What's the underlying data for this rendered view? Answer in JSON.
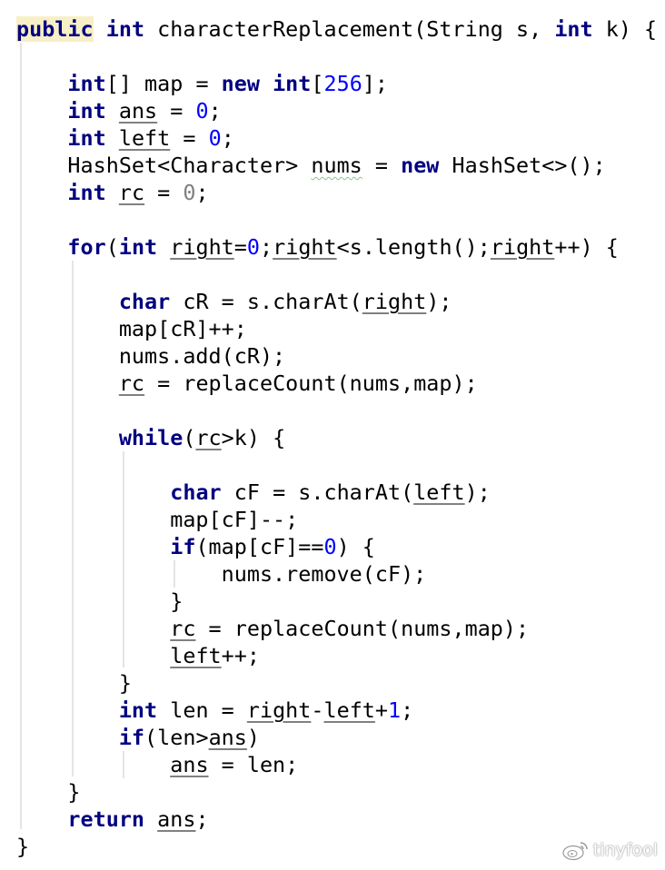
{
  "editor": {
    "lines": [
      [
        {
          "t": "public",
          "c": "kw hl"
        },
        {
          "t": " "
        },
        {
          "t": "int",
          "c": "kw"
        },
        {
          "t": " characterReplacement(String s, "
        },
        {
          "t": "int",
          "c": "kw"
        },
        {
          "t": " k) {"
        }
      ],
      [],
      [
        {
          "t": "    "
        },
        {
          "t": "int",
          "c": "kw"
        },
        {
          "t": "[] map = "
        },
        {
          "t": "new",
          "c": "kw"
        },
        {
          "t": " "
        },
        {
          "t": "int",
          "c": "kw"
        },
        {
          "t": "["
        },
        {
          "t": "256",
          "c": "num"
        },
        {
          "t": "];"
        }
      ],
      [
        {
          "t": "    "
        },
        {
          "t": "int",
          "c": "kw"
        },
        {
          "t": " "
        },
        {
          "t": "ans",
          "c": "field"
        },
        {
          "t": " = "
        },
        {
          "t": "0",
          "c": "num"
        },
        {
          "t": ";"
        }
      ],
      [
        {
          "t": "    "
        },
        {
          "t": "int",
          "c": "kw"
        },
        {
          "t": " "
        },
        {
          "t": "left",
          "c": "field"
        },
        {
          "t": " = "
        },
        {
          "t": "0",
          "c": "num"
        },
        {
          "t": ";"
        }
      ],
      [
        {
          "t": "    HashSet<Character> "
        },
        {
          "t": "nums",
          "c": "warn"
        },
        {
          "t": " = "
        },
        {
          "t": "new",
          "c": "kw"
        },
        {
          "t": " HashSet<>();"
        }
      ],
      [
        {
          "t": "    "
        },
        {
          "t": "int",
          "c": "kw"
        },
        {
          "t": " "
        },
        {
          "t": "rc",
          "c": "field"
        },
        {
          "t": " = "
        },
        {
          "t": "0",
          "c": "unused"
        },
        {
          "t": ";"
        }
      ],
      [],
      [
        {
          "t": "    "
        },
        {
          "t": "for",
          "c": "kw"
        },
        {
          "t": "("
        },
        {
          "t": "int",
          "c": "kw"
        },
        {
          "t": " "
        },
        {
          "t": "right",
          "c": "field"
        },
        {
          "t": "="
        },
        {
          "t": "0",
          "c": "num"
        },
        {
          "t": ";"
        },
        {
          "t": "right",
          "c": "field"
        },
        {
          "t": "<s.length();"
        },
        {
          "t": "right",
          "c": "field"
        },
        {
          "t": "++) {"
        }
      ],
      [],
      [
        {
          "t": "        "
        },
        {
          "t": "char",
          "c": "kw"
        },
        {
          "t": " cR = s.charAt("
        },
        {
          "t": "right",
          "c": "field"
        },
        {
          "t": ");"
        }
      ],
      [
        {
          "t": "        map[cR]++;"
        }
      ],
      [
        {
          "t": "        nums.add(cR);"
        }
      ],
      [
        {
          "t": "        "
        },
        {
          "t": "rc",
          "c": "field"
        },
        {
          "t": " = replaceCount(nums,map);"
        }
      ],
      [],
      [
        {
          "t": "        "
        },
        {
          "t": "while",
          "c": "kw"
        },
        {
          "t": "("
        },
        {
          "t": "rc",
          "c": "field"
        },
        {
          "t": ">k) {"
        }
      ],
      [],
      [
        {
          "t": "            "
        },
        {
          "t": "char",
          "c": "kw"
        },
        {
          "t": " cF = s.charAt("
        },
        {
          "t": "left",
          "c": "field"
        },
        {
          "t": ");"
        }
      ],
      [
        {
          "t": "            map[cF]--;"
        }
      ],
      [
        {
          "t": "            "
        },
        {
          "t": "if",
          "c": "kw"
        },
        {
          "t": "(map[cF]=="
        },
        {
          "t": "0",
          "c": "num"
        },
        {
          "t": ") {"
        }
      ],
      [
        {
          "t": "                nums.remove(cF);"
        }
      ],
      [
        {
          "t": "            }"
        }
      ],
      [
        {
          "t": "            "
        },
        {
          "t": "rc",
          "c": "field"
        },
        {
          "t": " = replaceCount(nums,map);"
        }
      ],
      [
        {
          "t": "            "
        },
        {
          "t": "left",
          "c": "field"
        },
        {
          "t": "++;"
        }
      ],
      [
        {
          "t": "        }"
        }
      ],
      [
        {
          "t": "        "
        },
        {
          "t": "int",
          "c": "kw"
        },
        {
          "t": " len = "
        },
        {
          "t": "right",
          "c": "field"
        },
        {
          "t": "-"
        },
        {
          "t": "left",
          "c": "field"
        },
        {
          "t": "+"
        },
        {
          "t": "1",
          "c": "num"
        },
        {
          "t": ";"
        }
      ],
      [
        {
          "t": "        "
        },
        {
          "t": "if",
          "c": "kw"
        },
        {
          "t": "(len>"
        },
        {
          "t": "ans",
          "c": "field"
        },
        {
          "t": ")"
        }
      ],
      [
        {
          "t": "            "
        },
        {
          "t": "ans",
          "c": "field"
        },
        {
          "t": " = len;"
        }
      ],
      [
        {
          "t": "    }"
        }
      ],
      [
        {
          "t": "    "
        },
        {
          "t": "return",
          "c": "kw"
        },
        {
          "t": " "
        },
        {
          "t": "ans",
          "c": "field"
        },
        {
          "t": ";"
        }
      ],
      [
        {
          "t": "}"
        }
      ]
    ]
  },
  "watermark": {
    "icon": "weibo-icon",
    "text": "tinyfool"
  }
}
